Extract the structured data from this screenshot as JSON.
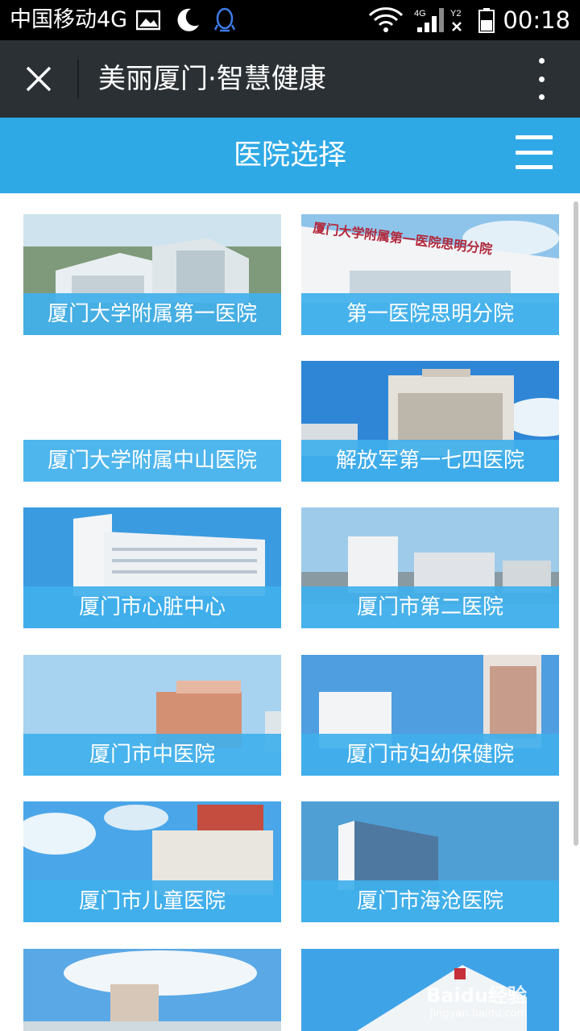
{
  "status_bar": {
    "carrier": "中国移动4G",
    "network": "4G",
    "sim": "Y2",
    "time": "00:18",
    "icons": [
      "gallery-icon",
      "moon-icon",
      "qq-icon",
      "wifi-icon",
      "signal-icon",
      "battery-icon"
    ]
  },
  "title_bar": {
    "title": "美丽厦门·智慧健康",
    "close_icon": "close-icon",
    "more_icon": "more-vertical-icon"
  },
  "header": {
    "title": "医院选择",
    "menu_icon": "menu-icon"
  },
  "hospitals": [
    {
      "name": "厦门大学附属第一医院",
      "has_image": true
    },
    {
      "name": "第一医院思明分院",
      "has_image": true
    },
    {
      "name": "厦门大学附属中山医院",
      "has_image": false
    },
    {
      "name": "解放军第一七四医院",
      "has_image": true
    },
    {
      "name": "厦门市心脏中心",
      "has_image": true
    },
    {
      "name": "厦门市第二医院",
      "has_image": true
    },
    {
      "name": "厦门市中医院",
      "has_image": true
    },
    {
      "name": "厦门市妇幼保健院",
      "has_image": true
    },
    {
      "name": "厦门市儿童医院",
      "has_image": true
    },
    {
      "name": "厦门市海沧医院",
      "has_image": true
    },
    {
      "name": "",
      "has_image": true
    },
    {
      "name": "",
      "has_image": true
    }
  ],
  "watermark": {
    "brand": "Baidu经验",
    "url": "jingyan.baidu.com"
  },
  "colors": {
    "status_bar": "#000000",
    "title_bar": "#2b3034",
    "accent": "#2ea9e6",
    "card_label": "#40b0ec"
  }
}
